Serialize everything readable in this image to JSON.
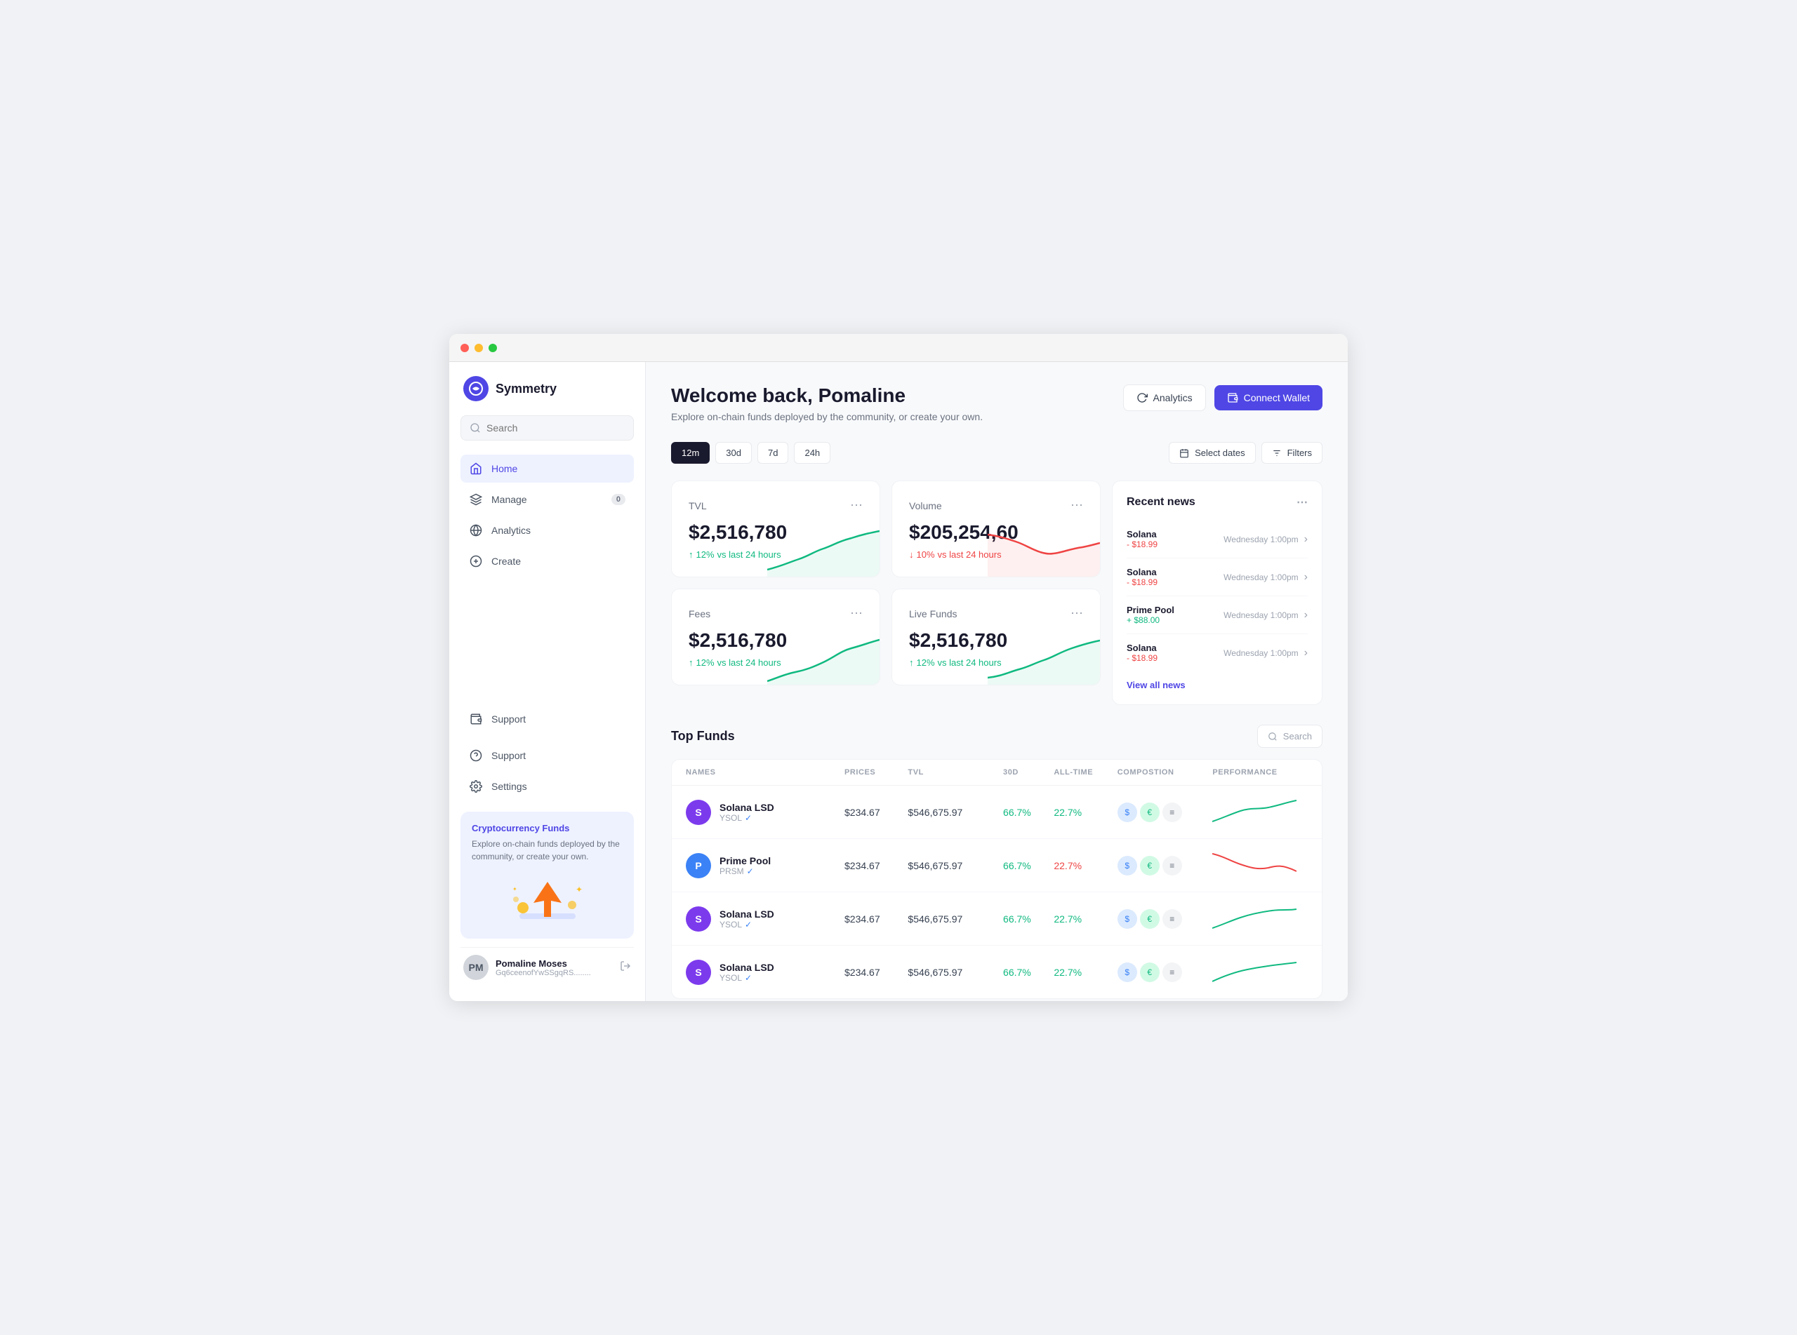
{
  "window": {
    "title": "Symmetry"
  },
  "logo": {
    "text": "Symmetry",
    "icon": "S"
  },
  "search": {
    "placeholder": "Search"
  },
  "nav": {
    "items": [
      {
        "id": "home",
        "label": "Home",
        "icon": "home",
        "active": true
      },
      {
        "id": "manage",
        "label": "Manage",
        "icon": "layers",
        "active": false,
        "badge": "0"
      },
      {
        "id": "analytics",
        "label": "Analytics",
        "icon": "analytics",
        "active": false
      },
      {
        "id": "create",
        "label": "Create",
        "icon": "plus-circle",
        "active": false
      }
    ],
    "bottom": [
      {
        "id": "support",
        "label": "Support",
        "icon": "help-circle"
      },
      {
        "id": "settings",
        "label": "Settings",
        "icon": "settings"
      }
    ]
  },
  "promo": {
    "title": "Cryptocurrency Funds",
    "description": "Explore on-chain funds deployed by the community, or create your own."
  },
  "user": {
    "name": "Pomaline Moses",
    "address": "Gq6ceenofYwSSgqRS........"
  },
  "header": {
    "welcome": "Welcome back, Pomaline",
    "subtitle": "Explore on-chain funds deployed by the community, or create your own.",
    "analytics_label": "Analytics",
    "connect_wallet_label": "Connect Wallet"
  },
  "time_filters": {
    "options": [
      "12m",
      "30d",
      "7d",
      "24h"
    ],
    "active": "12m",
    "select_dates": "Select dates",
    "filters": "Filters"
  },
  "stats": [
    {
      "id": "tvl",
      "label": "TVL",
      "value": "$2,516,780",
      "change": "12%",
      "change_dir": "up",
      "change_text": "vs last 24 hours",
      "chart_color": "#10b981",
      "chart_type": "up"
    },
    {
      "id": "volume",
      "label": "Volume",
      "value": "$205,254,60",
      "change": "10%",
      "change_dir": "down",
      "change_text": "vs last 24 hours",
      "chart_color": "#ef4444",
      "chart_type": "down"
    },
    {
      "id": "fees",
      "label": "Fees",
      "value": "$2,516,780",
      "change": "12%",
      "change_dir": "up",
      "change_text": "vs last 24 hours",
      "chart_color": "#10b981",
      "chart_type": "up"
    },
    {
      "id": "live-funds",
      "label": "Live Funds",
      "value": "$2,516,780",
      "change": "12%",
      "change_dir": "up",
      "change_text": "vs last 24 hours",
      "chart_color": "#10b981",
      "chart_type": "up"
    }
  ],
  "news": {
    "title": "Recent news",
    "items": [
      {
        "coin": "Solana",
        "price": "- $18.99",
        "dir": "down",
        "time": "Wednesday 1:00pm"
      },
      {
        "coin": "Solana",
        "price": "- $18.99",
        "dir": "down",
        "time": "Wednesday 1:00pm"
      },
      {
        "coin": "Prime Pool",
        "price": "+ $88.00",
        "dir": "up",
        "time": "Wednesday 1:00pm"
      },
      {
        "coin": "Solana",
        "price": "- $18.99",
        "dir": "down",
        "time": "Wednesday 1:00pm"
      }
    ],
    "view_all": "View all news"
  },
  "top_funds": {
    "title": "Top Funds",
    "search_placeholder": "Search",
    "columns": [
      "NAMES",
      "PRICES",
      "TVL",
      "30D",
      "ALL-TIME",
      "COMPOSTION",
      "PERFORMANCE"
    ],
    "rows": [
      {
        "name": "Solana LSD",
        "ticker": "YSOL",
        "verified": true,
        "price": "$234.67",
        "tvl": "$546,675.97",
        "d30": "66.7%",
        "d30_dir": "green",
        "alltime": "22.7%",
        "alltime_dir": "green",
        "avatar_bg": "purple",
        "avatar_letter": "S",
        "perf_dir": "up"
      },
      {
        "name": "Prime Pool",
        "ticker": "PRSM",
        "verified": true,
        "price": "$234.67",
        "tvl": "$546,675.97",
        "d30": "66.7%",
        "d30_dir": "green",
        "alltime": "22.7%",
        "alltime_dir": "red",
        "avatar_bg": "blue",
        "avatar_letter": "P",
        "perf_dir": "down"
      },
      {
        "name": "Solana LSD",
        "ticker": "YSOL",
        "verified": true,
        "price": "$234.67",
        "tvl": "$546,675.97",
        "d30": "66.7%",
        "d30_dir": "green",
        "alltime": "22.7%",
        "alltime_dir": "green",
        "avatar_bg": "purple",
        "avatar_letter": "S",
        "perf_dir": "up"
      },
      {
        "name": "Solana LSD",
        "ticker": "YSOL",
        "verified": true,
        "price": "$234.67",
        "tvl": "$546,675.97",
        "d30": "66.7%",
        "d30_dir": "green",
        "alltime": "22.7%",
        "alltime_dir": "green",
        "avatar_bg": "purple",
        "avatar_letter": "S",
        "perf_dir": "up"
      }
    ]
  }
}
